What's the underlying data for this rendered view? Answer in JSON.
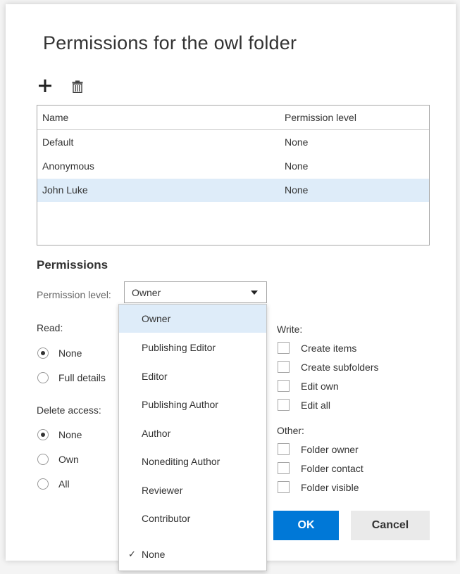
{
  "dialog": {
    "title": "Permissions for the owl folder",
    "add_icon": "plus-icon",
    "delete_icon": "trash-icon"
  },
  "table": {
    "columns": [
      "Name",
      "Permission level"
    ],
    "rows": [
      {
        "name": "Default",
        "level": "None"
      },
      {
        "name": "Anonymous",
        "level": "None"
      },
      {
        "name": "John Luke",
        "level": "None"
      }
    ],
    "selected_row": 2
  },
  "permissions": {
    "heading": "Permissions",
    "level_label": "Permission level:",
    "level_value": "Owner"
  },
  "read": {
    "label": "Read:",
    "options": [
      {
        "label": "None",
        "checked": true
      },
      {
        "label": "Full details",
        "checked": false
      }
    ]
  },
  "delete_access": {
    "label": "Delete access:",
    "options": [
      {
        "label": "None",
        "checked": true
      },
      {
        "label": "Own",
        "checked": false
      },
      {
        "label": "All",
        "checked": false
      }
    ]
  },
  "write": {
    "label": "Write:",
    "items": [
      "Create items",
      "Create subfolders",
      "Edit own",
      "Edit all"
    ]
  },
  "other": {
    "label": "Other:",
    "items": [
      "Folder owner",
      "Folder contact",
      "Folder visible"
    ]
  },
  "buttons": {
    "ok": "OK",
    "cancel": "Cancel"
  },
  "dropdown": {
    "items": [
      "Owner",
      "Publishing Editor",
      "Editor",
      "Publishing Author",
      "Author",
      "Nonediting Author",
      "Reviewer",
      "Contributor",
      "None"
    ],
    "highlighted": "Owner",
    "checked": "None",
    "check_glyph": "✓"
  },
  "colors": {
    "accent": "#0078d7",
    "selection": "#deecf9"
  }
}
